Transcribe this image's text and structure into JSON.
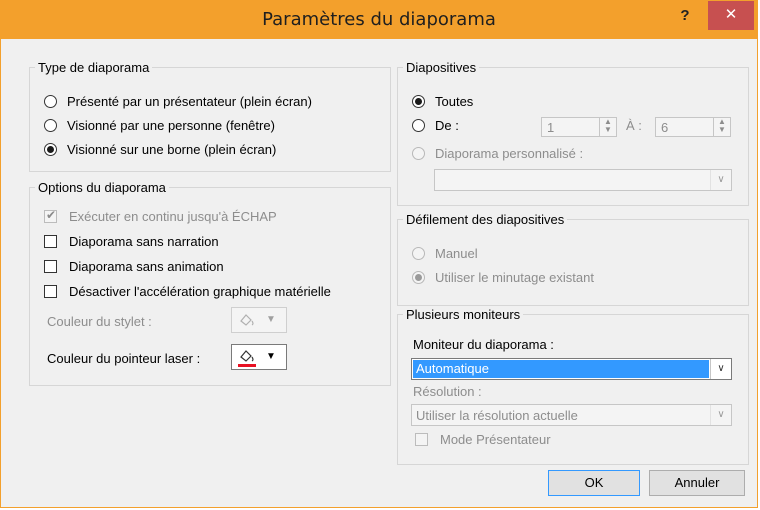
{
  "window": {
    "title": "Paramètres du diaporama",
    "help": "?",
    "close": "✕"
  },
  "type_group": {
    "legend": "Type de diaporama",
    "options": [
      {
        "label": "Présenté par un présentateur (plein écran)",
        "checked": false
      },
      {
        "label": "Visionné par une personne (fenêtre)",
        "checked": false
      },
      {
        "label": "Visionné sur une borne (plein écran)",
        "checked": true
      }
    ]
  },
  "options_group": {
    "legend": "Options du diaporama",
    "checks": [
      {
        "label": "Exécuter en continu jusqu'à ÉCHAP",
        "checked": true,
        "disabled": true
      },
      {
        "label": "Diaporama sans narration",
        "checked": false,
        "disabled": false
      },
      {
        "label": "Diaporama sans animation",
        "checked": false,
        "disabled": false
      },
      {
        "label": "Désactiver l'accélération graphique matérielle",
        "checked": false,
        "disabled": false
      }
    ],
    "pen_color_label": "Couleur du stylet :",
    "laser_color_label": "Couleur du pointeur laser :",
    "laser_color": "#e81123",
    "pen_color": "#c8c8c8"
  },
  "slides_group": {
    "legend": "Diapositives",
    "all_label": "Toutes",
    "from_label": "De :",
    "from_value": "1",
    "to_label": "À :",
    "to_value": "6",
    "custom_label": "Diaporama personnalisé :",
    "custom_value": ""
  },
  "advance_group": {
    "legend": "Défilement des diapositives",
    "manual_label": "Manuel",
    "timing_label": "Utiliser le minutage existant"
  },
  "monitors_group": {
    "legend": "Plusieurs moniteurs",
    "monitor_label": "Moniteur du diaporama :",
    "monitor_value": "Automatique",
    "resolution_label": "Résolution :",
    "resolution_value": "Utiliser la résolution actuelle",
    "presenter_label": "Mode Présentateur"
  },
  "buttons": {
    "ok": "OK",
    "cancel": "Annuler"
  }
}
